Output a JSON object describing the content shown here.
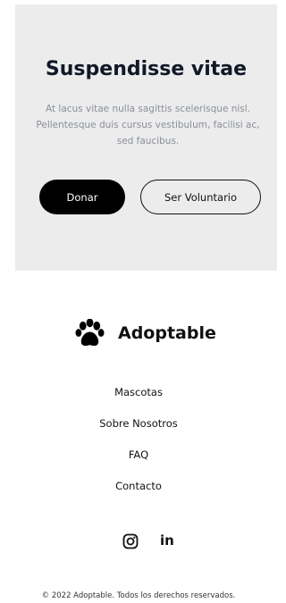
{
  "hero": {
    "title": "Suspendisse vitae",
    "text": "At lacus vitae nulla sagittis scelerisque nisl. Pellentesque duis cursus vestibulum, facilisi ac, sed faucibus.",
    "primary_button": "Donar",
    "secondary_button": "Ser Voluntario"
  },
  "footer": {
    "brand": "Adoptable",
    "brand_icon": "paw-icon",
    "nav": [
      "Mascotas",
      "Sobre Nosotros",
      "FAQ",
      "Contacto"
    ],
    "social": [
      {
        "name": "instagram",
        "icon": "instagram-icon"
      },
      {
        "name": "linkedin",
        "icon": "linkedin-icon",
        "glyph": "in"
      }
    ],
    "copyright": "© 2022 Adoptable. Todos los derechos reservados."
  },
  "colors": {
    "hero_bg": "#ececec",
    "primary_button_bg": "#000000",
    "text_dark": "#111827",
    "text_muted": "#8a8f98"
  }
}
